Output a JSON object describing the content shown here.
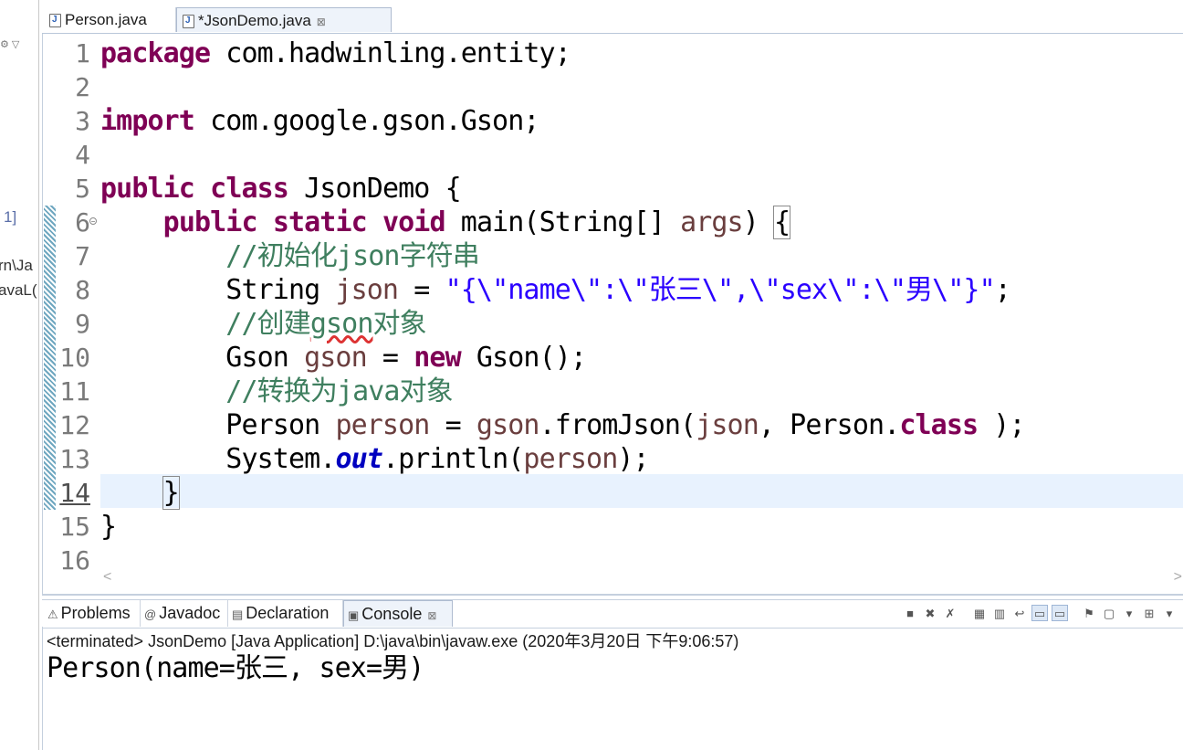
{
  "left_fragments": [
    "1]",
    "rn\\Ja",
    "avaL("
  ],
  "editor_tabs": [
    {
      "label": "Person.java",
      "active": false
    },
    {
      "label": "*JsonDemo.java",
      "active": true,
      "close": "⊠"
    }
  ],
  "line_numbers": [
    "1",
    "2",
    "3",
    "4",
    "5",
    "6",
    "7",
    "8",
    "9",
    "10",
    "11",
    "12",
    "13",
    "14",
    "15",
    "16"
  ],
  "code": {
    "l1_kw": "package",
    "l1_rest": " com.hadwinling.entity;",
    "l3_kw": "import",
    "l3_rest": " com.google.gson.Gson;",
    "l5_kw1": "public",
    "l5_kw2": "class",
    "l5_rest": " JsonDemo {",
    "l6_kw1": "public",
    "l6_kw2": "static",
    "l6_kw3": "void",
    "l6_mid": " main(String[] ",
    "l6_var": "args",
    "l6_end": ") ",
    "l6_brace": "{",
    "l7_comment": "//初始化json字符串",
    "l8_type": "String ",
    "l8_var": "json",
    "l8_eq": " = ",
    "l8_str": "\"{\\\"name\\\":\\\"张三\\\",\\\"sex\\\":\\\"男\\\"}\"",
    "l8_end": ";",
    "l9_comment_a": "//创建",
    "l9_comment_b": "gson",
    "l9_comment_c": "对象",
    "l10_type": "Gson ",
    "l10_var": "gson",
    "l10_eq": " = ",
    "l10_kw": "new",
    "l10_end": " Gson();",
    "l11_comment": "//转换为java对象",
    "l12_type": "Person ",
    "l12_var": "person",
    "l12_eq": " = ",
    "l12_var2": "gson",
    "l12_mid": ".fromJson(",
    "l12_var3": "json",
    "l12_mid2": ", Person.",
    "l12_kw": "class",
    "l12_end": " );",
    "l13_a": "System.",
    "l13_static": "out",
    "l13_b": ".println(",
    "l13_var": "person",
    "l13_end": ");",
    "l14": "}",
    "l15": "}"
  },
  "panel_tabs": [
    {
      "label": "Problems",
      "icon": "problems-icon"
    },
    {
      "label": "Javadoc",
      "icon": "javadoc-icon"
    },
    {
      "label": "Declaration",
      "icon": "declaration-icon"
    },
    {
      "label": "Console",
      "icon": "console-icon",
      "close": "⊠",
      "active": true
    }
  ],
  "console": {
    "status": "<terminated> JsonDemo [Java Application] D:\\java\\bin\\javaw.exe (2020年3月20日 下午9:06:57)",
    "output": "Person(name=张三, sex=男)"
  },
  "colors": {
    "keyword": "#7f0055",
    "comment": "#3f7f5f",
    "string": "#2a00ff",
    "variable": "#6a3e3e",
    "current_line": "#e8f2fe"
  }
}
